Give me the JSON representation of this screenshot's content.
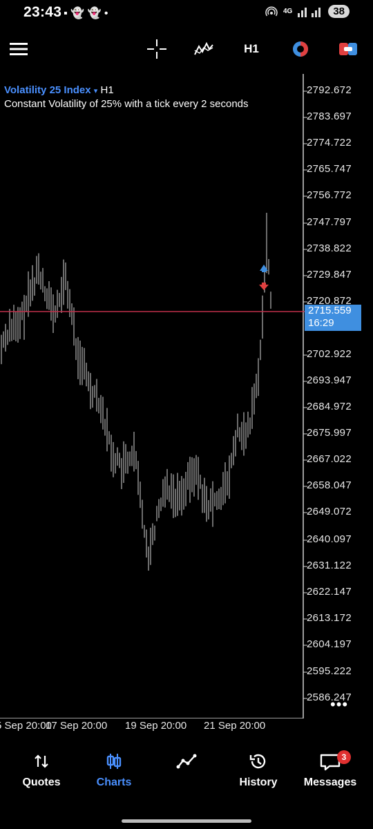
{
  "status_bar": {
    "time": "23:43",
    "notifications": "▪ 👻 👻 •",
    "network": "4G",
    "battery": "38"
  },
  "toolbar": {
    "timeframe": "H1",
    "icons": [
      "menu-icon",
      "crosshair-icon",
      "indicators-icon",
      "timeframe",
      "objects-icon",
      "trade-icon"
    ]
  },
  "chart": {
    "symbol": "Volatility 25 Index",
    "dropdown_glyph": "▾",
    "timeframe": "H1",
    "description": "Constant Volatility of 25% with a tick every 2 seconds",
    "current_price": "2715.559",
    "countdown": "16:29",
    "bid_color": "#3f8fe0",
    "line_color": "#c0304a",
    "price_labels": [
      "2792.672",
      "2783.697",
      "2774.722",
      "2765.747",
      "2756.772",
      "2747.797",
      "2738.822",
      "2729.847",
      "2720.872",
      "2702.922",
      "2693.947",
      "2684.972",
      "2675.997",
      "2667.022",
      "2658.047",
      "2649.072",
      "2640.097",
      "2631.122",
      "2622.147",
      "2613.172",
      "2604.197",
      "2595.222",
      "2586.247"
    ],
    "time_labels": [
      "5 Sep 20:00",
      "17 Sep 20:00",
      "19 Sep 20:00",
      "21 Sep 20:00"
    ],
    "more_glyph": "•••"
  },
  "bottom_nav": {
    "items": [
      {
        "label": "Quotes",
        "icon": "quotes-icon"
      },
      {
        "label": "Charts",
        "icon": "charts-icon",
        "active": true
      },
      {
        "label": "",
        "icon": "trade-line-icon"
      },
      {
        "label": "History",
        "icon": "history-icon"
      },
      {
        "label": "Messages",
        "icon": "messages-icon",
        "badge": "3"
      }
    ]
  }
}
